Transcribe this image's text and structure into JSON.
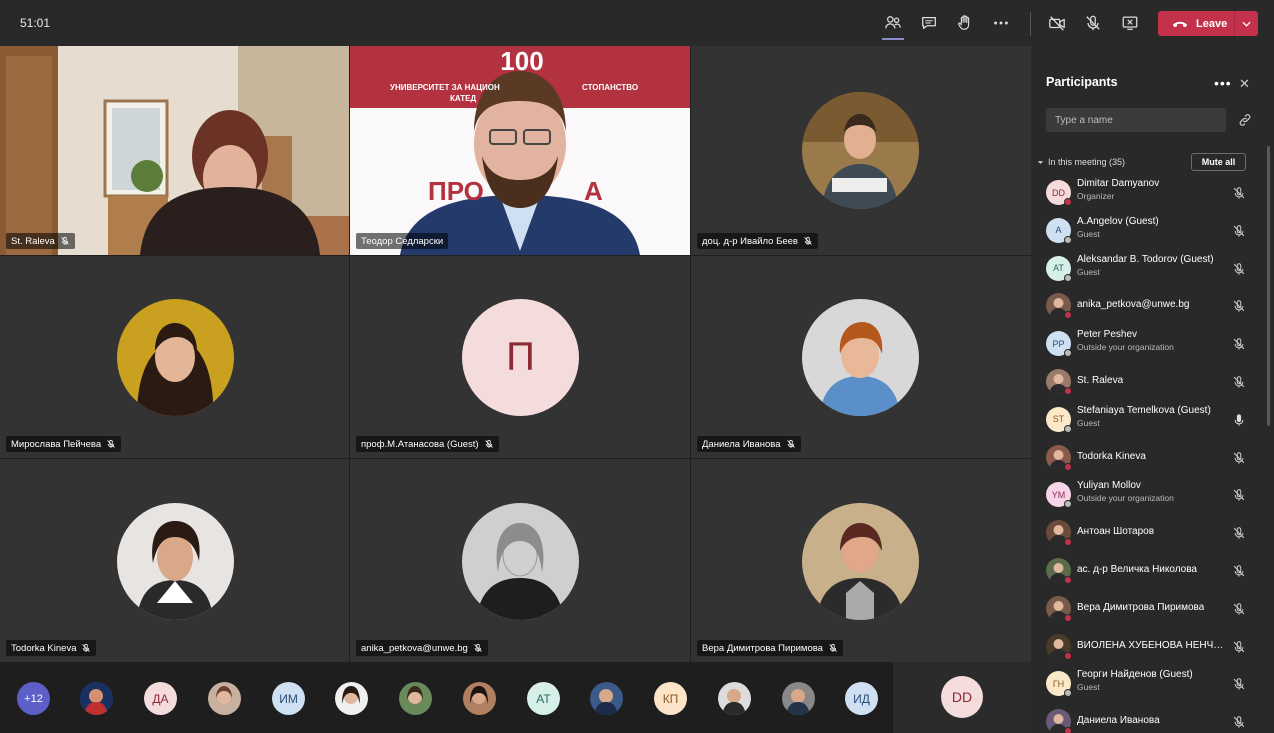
{
  "meeting": {
    "timer": "51:01"
  },
  "toolbar": {
    "icons": [
      "people-icon",
      "chat-icon",
      "raise-hand-icon",
      "more-icon",
      "camera-off-icon",
      "mic-off-icon",
      "share-tray-icon"
    ],
    "leave_label": "Leave"
  },
  "grid": {
    "tiles": [
      {
        "name": "St. Raleva"
      },
      {
        "name": "Теодор Седларски",
        "banner_line": "УНИВЕРСИТЕТ ЗА НАЦИОН",
        "banner_line2": "СТОПАНСТВО",
        "banner_line3": "КАТЕД",
        "logo": "100",
        "slide_text": "ПРО",
        "slide_text2": "А"
      },
      {
        "name": "доц. д-р Ивайло Беев"
      },
      {
        "name": "Мирослава Пейчева"
      },
      {
        "name": "проф.М.Атанасова (Guest)",
        "initial": "П"
      },
      {
        "name": "Даниела Иванова"
      },
      {
        "name": "Todorka Kineva"
      },
      {
        "name": "anika_petkova@unwe.bg"
      },
      {
        "name": "Вера Димитрова Пиримова"
      }
    ]
  },
  "strip": {
    "overflow_label": "+12",
    "avatars": [
      {
        "initials": ""
      },
      {
        "initials": "ДА"
      },
      {
        "initials": ""
      },
      {
        "initials": "ИМ"
      },
      {
        "initials": ""
      },
      {
        "initials": ""
      },
      {
        "initials": ""
      },
      {
        "initials": "АТ"
      },
      {
        "initials": ""
      },
      {
        "initials": "КП"
      },
      {
        "initials": ""
      },
      {
        "initials": ""
      },
      {
        "initials": "ИД"
      }
    ],
    "self_initials": "DD"
  },
  "panel": {
    "title": "Participants",
    "search_placeholder": "Type a name",
    "section_label": "In this meeting (35)",
    "mute_all_label": "Mute all",
    "participants": [
      {
        "initials": "DD",
        "name": "Dimitar Damyanov",
        "sub": "Organizer",
        "mic": "off"
      },
      {
        "initials": "A",
        "name": "A.Angelov (Guest)",
        "sub": "Guest",
        "mic": "off"
      },
      {
        "initials": "AT",
        "name": "Aleksandar B. Todorov (Guest)",
        "sub": "Guest",
        "mic": "off"
      },
      {
        "initials": "",
        "name": "anika_petkova@unwe.bg",
        "sub": "",
        "mic": "off"
      },
      {
        "initials": "PP",
        "name": "Peter Peshev",
        "sub": "Outside your organization",
        "mic": "off"
      },
      {
        "initials": "",
        "name": "St. Raleva",
        "sub": "",
        "mic": "off"
      },
      {
        "initials": "ST",
        "name": "Stefaniaya Temelkova (Guest)",
        "sub": "Guest",
        "mic": "on"
      },
      {
        "initials": "",
        "name": "Todorka Kineva",
        "sub": "",
        "mic": "off"
      },
      {
        "initials": "YM",
        "name": "Yuliyan Mollov",
        "sub": "Outside your organization",
        "mic": "off"
      },
      {
        "initials": "",
        "name": "Антоан Шотаров",
        "sub": "",
        "mic": "off"
      },
      {
        "initials": "",
        "name": "ас. д-р Величка Николова",
        "sub": "",
        "mic": "off"
      },
      {
        "initials": "",
        "name": "Вера Димитрова Пиримова",
        "sub": "",
        "mic": "off"
      },
      {
        "initials": "",
        "name": "ВИОЛЕНА ХУБЕНОВА НЕНЧЕ...",
        "sub": "",
        "mic": "off"
      },
      {
        "initials": "ГН",
        "name": "Георги Найденов (Guest)",
        "sub": "Guest",
        "mic": "off"
      },
      {
        "initials": "",
        "name": "Даниела Иванова",
        "sub": "",
        "mic": "off"
      }
    ]
  }
}
